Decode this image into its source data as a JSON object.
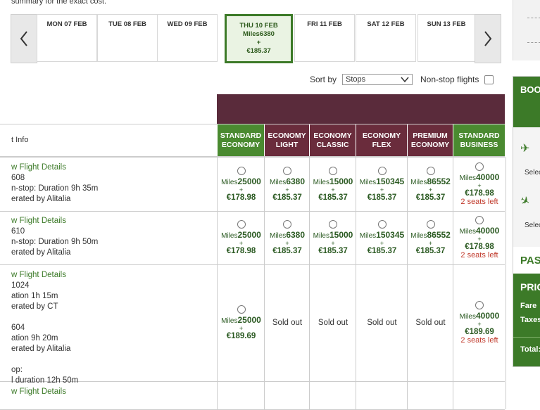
{
  "notice": "summary for the exact cost.",
  "dates": [
    {
      "label": "MON 07 FEB"
    },
    {
      "label": "TUE 08 FEB"
    },
    {
      "label": "WED 09 FEB"
    },
    {
      "label": "THU 10 FEB",
      "miles": "Miles6380",
      "plus": "+",
      "price": "€185.37"
    },
    {
      "label": "FRI 11 FEB"
    },
    {
      "label": "SAT 12 FEB"
    },
    {
      "label": "SUN 13 FEB"
    }
  ],
  "sort": {
    "label": "Sort by",
    "value": "Stops",
    "nonstop_label": "Non-stop flights"
  },
  "table": {
    "first_col": "t Info",
    "columns": [
      "STANDARD ECONOMY",
      "ECONOMY LIGHT",
      "ECONOMY CLASSIC",
      "ECONOMY FLEX",
      "PREMIUM ECONOMY",
      "STANDARD BUSINESS"
    ],
    "rows": [
      {
        "info": [
          "w Flight Details",
          "608",
          "n-stop: Duration 9h 35m",
          "erated by Alitalia"
        ],
        "cells": [
          {
            "miles": "25000",
            "price": "€178.98"
          },
          {
            "miles": "6380",
            "price": "€185.37"
          },
          {
            "miles": "15000",
            "price": "€185.37"
          },
          {
            "miles": "150345",
            "price": "€185.37"
          },
          {
            "miles": "86552",
            "price": "€185.37"
          },
          {
            "miles": "40000",
            "price": "€178.98",
            "seats": "2 seats left"
          }
        ]
      },
      {
        "info": [
          "w Flight Details",
          "610",
          "n-stop: Duration 9h 50m",
          "erated by Alitalia"
        ],
        "cells": [
          {
            "miles": "25000",
            "price": "€178.98"
          },
          {
            "miles": "6380",
            "price": "€185.37"
          },
          {
            "miles": "15000",
            "price": "€185.37"
          },
          {
            "miles": "150345",
            "price": "€185.37"
          },
          {
            "miles": "86552",
            "price": "€185.37"
          },
          {
            "miles": "40000",
            "price": "€178.98",
            "seats": "2 seats left"
          }
        ]
      },
      {
        "info": [
          "w Flight Details",
          "1024",
          "ation 1h 15m",
          "erated by CT",
          "",
          "604",
          "ation 9h 20m",
          "erated by Alitalia",
          "",
          "op:",
          "l duration 12h 50m"
        ],
        "cells": [
          {
            "miles": "25000",
            "price": "€189.69"
          },
          {
            "sold": "Sold out"
          },
          {
            "sold": "Sold out"
          },
          {
            "sold": "Sold out"
          },
          {
            "sold": "Sold out"
          },
          {
            "miles": "40000",
            "price": "€189.69",
            "seats": "2 seats left"
          }
        ]
      },
      {
        "info": [
          "w Flight Details"
        ],
        "cells": [
          {},
          {},
          {},
          {},
          {},
          {}
        ]
      }
    ],
    "miles_prefix": "Miles",
    "plus": "+"
  },
  "sidebar": {
    "book": "BOO",
    "select": "Selec",
    "passengers": "PASS",
    "price": "PRIC",
    "fare": "Fare",
    "taxes": "Taxes",
    "total": "Total:"
  }
}
